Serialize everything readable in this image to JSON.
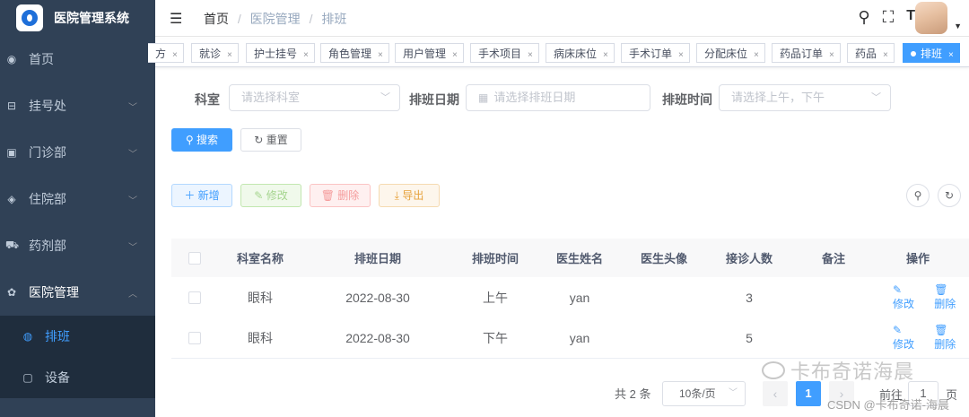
{
  "app": {
    "title": "医院管理系统"
  },
  "sidebar": {
    "items": [
      {
        "label": "首页",
        "icon": "dashboard-icon",
        "glyph": "◉"
      },
      {
        "label": "挂号处",
        "icon": "register-icon",
        "glyph": "⊟"
      },
      {
        "label": "门诊部",
        "icon": "clinic-icon",
        "glyph": "▣"
      },
      {
        "label": "住院部",
        "icon": "inpatient-icon",
        "glyph": "◈"
      },
      {
        "label": "药剂部",
        "icon": "pharmacy-icon",
        "glyph": "⛟"
      },
      {
        "label": "医院管理",
        "icon": "settings-icon",
        "glyph": "✿"
      }
    ],
    "subitems": [
      {
        "label": "排班",
        "icon": "schedule-icon",
        "glyph": "◍"
      },
      {
        "label": "设备",
        "icon": "equipment-icon",
        "glyph": "▢"
      }
    ]
  },
  "navbar": {
    "breadcrumb": [
      "首页",
      "医院管理",
      "排班"
    ],
    "icons": [
      "search-icon",
      "fullscreen-icon",
      "font-size-icon"
    ]
  },
  "tags": [
    "方",
    "就诊",
    "护士挂号",
    "角色管理",
    "用户管理",
    "手术项目",
    "病床床位",
    "手术订单",
    "分配床位",
    "药品订单",
    "药品",
    "排班"
  ],
  "search": {
    "dept_label": "科室",
    "dept_placeholder": "请选择科室",
    "date_label": "排班日期",
    "date_placeholder": "请选择排班日期",
    "time_label": "排班时间",
    "time_placeholder": "请选择上午，下午",
    "search_btn": "搜索",
    "reset_btn": "重置"
  },
  "toolbar": {
    "add": "新增",
    "edit": "修改",
    "delete": "删除",
    "export": "导出"
  },
  "table": {
    "headers": [
      "科室名称",
      "排班日期",
      "排班时间",
      "医生姓名",
      "医生头像",
      "接诊人数",
      "备注",
      "操作"
    ],
    "rows": [
      {
        "dept": "眼科",
        "date": "2022-08-30",
        "time": "上午",
        "doctor": "yan",
        "avatar": "",
        "count": "3",
        "note": "",
        "edit": "修改",
        "delete": "删除"
      },
      {
        "dept": "眼科",
        "date": "2022-08-30",
        "time": "下午",
        "doctor": "yan",
        "avatar": "",
        "count": "5",
        "note": "",
        "edit": "修改",
        "delete": "删除"
      }
    ]
  },
  "pagination": {
    "total": "共 2 条",
    "size": "10条/页",
    "current": "1",
    "goto": "前往",
    "goto_value": "1",
    "page_unit": "页"
  },
  "watermark": {
    "text": "卡布奇诺海晨",
    "credit": "CSDN @卡布奇诺-海晨"
  },
  "colors": {
    "primary": "#409eff",
    "sidebar_bg": "#304156",
    "submenu_bg": "#1f2d3d"
  }
}
